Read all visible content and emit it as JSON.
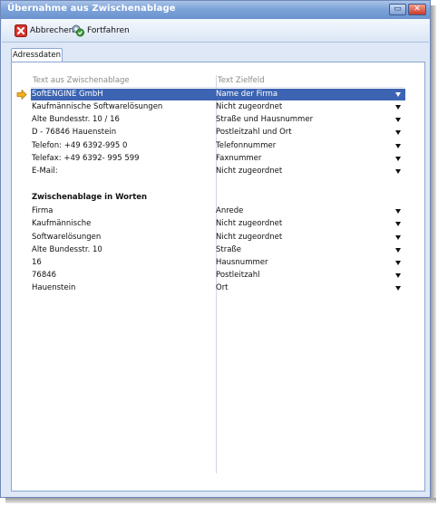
{
  "window": {
    "title": "Übernahme aus Zwischenablage",
    "restore_glyph": "▭",
    "close_glyph": "✕"
  },
  "toolbar": {
    "cancel_label": "Abbrechen",
    "proceed_label": "Fortfahren"
  },
  "tabs": [
    {
      "label": "Adressdaten"
    }
  ],
  "table": {
    "headers": {
      "source": "Text aus Zwischenablage",
      "target": "Text Zielfeld"
    },
    "rows": [
      {
        "source": "SoftENGINE GmbH",
        "target": "Name der Firma",
        "selected": true
      },
      {
        "source": "Kaufmännische Softwarelösungen",
        "target": "Nicht zugeordnet"
      },
      {
        "source": "Alte Bundesstr. 10 / 16",
        "target": "Straße und Hausnummer"
      },
      {
        "source": "D - 76846 Hauenstein",
        "target": "Postleitzahl und Ort"
      },
      {
        "source": "Telefon: +49 6392-995 0",
        "target": "Telefonnummer"
      },
      {
        "source": "Telefax: +49 6392- 995 599",
        "target": "Faxnummer"
      },
      {
        "source": "E-Mail:",
        "target": "Nicht zugeordnet"
      }
    ],
    "section_title": "Zwischenablage in Worten",
    "word_rows": [
      {
        "source": "Firma",
        "target": "Anrede"
      },
      {
        "source": "Kaufmännische",
        "target": "Nicht zugeordnet"
      },
      {
        "source": "Softwarelösungen",
        "target": "Nicht zugeordnet"
      },
      {
        "source": "Alte Bundesstr. 10",
        "target": "Straße"
      },
      {
        "source": "16",
        "target": "Hausnummer"
      },
      {
        "source": "76846",
        "target": "Postleitzahl"
      },
      {
        "source": "Hauenstein",
        "target": "Ort"
      }
    ]
  },
  "colors": {
    "selection": "#3d64b2",
    "titlebar": "#6b93cf",
    "window_bg": "#dfe8f6"
  }
}
